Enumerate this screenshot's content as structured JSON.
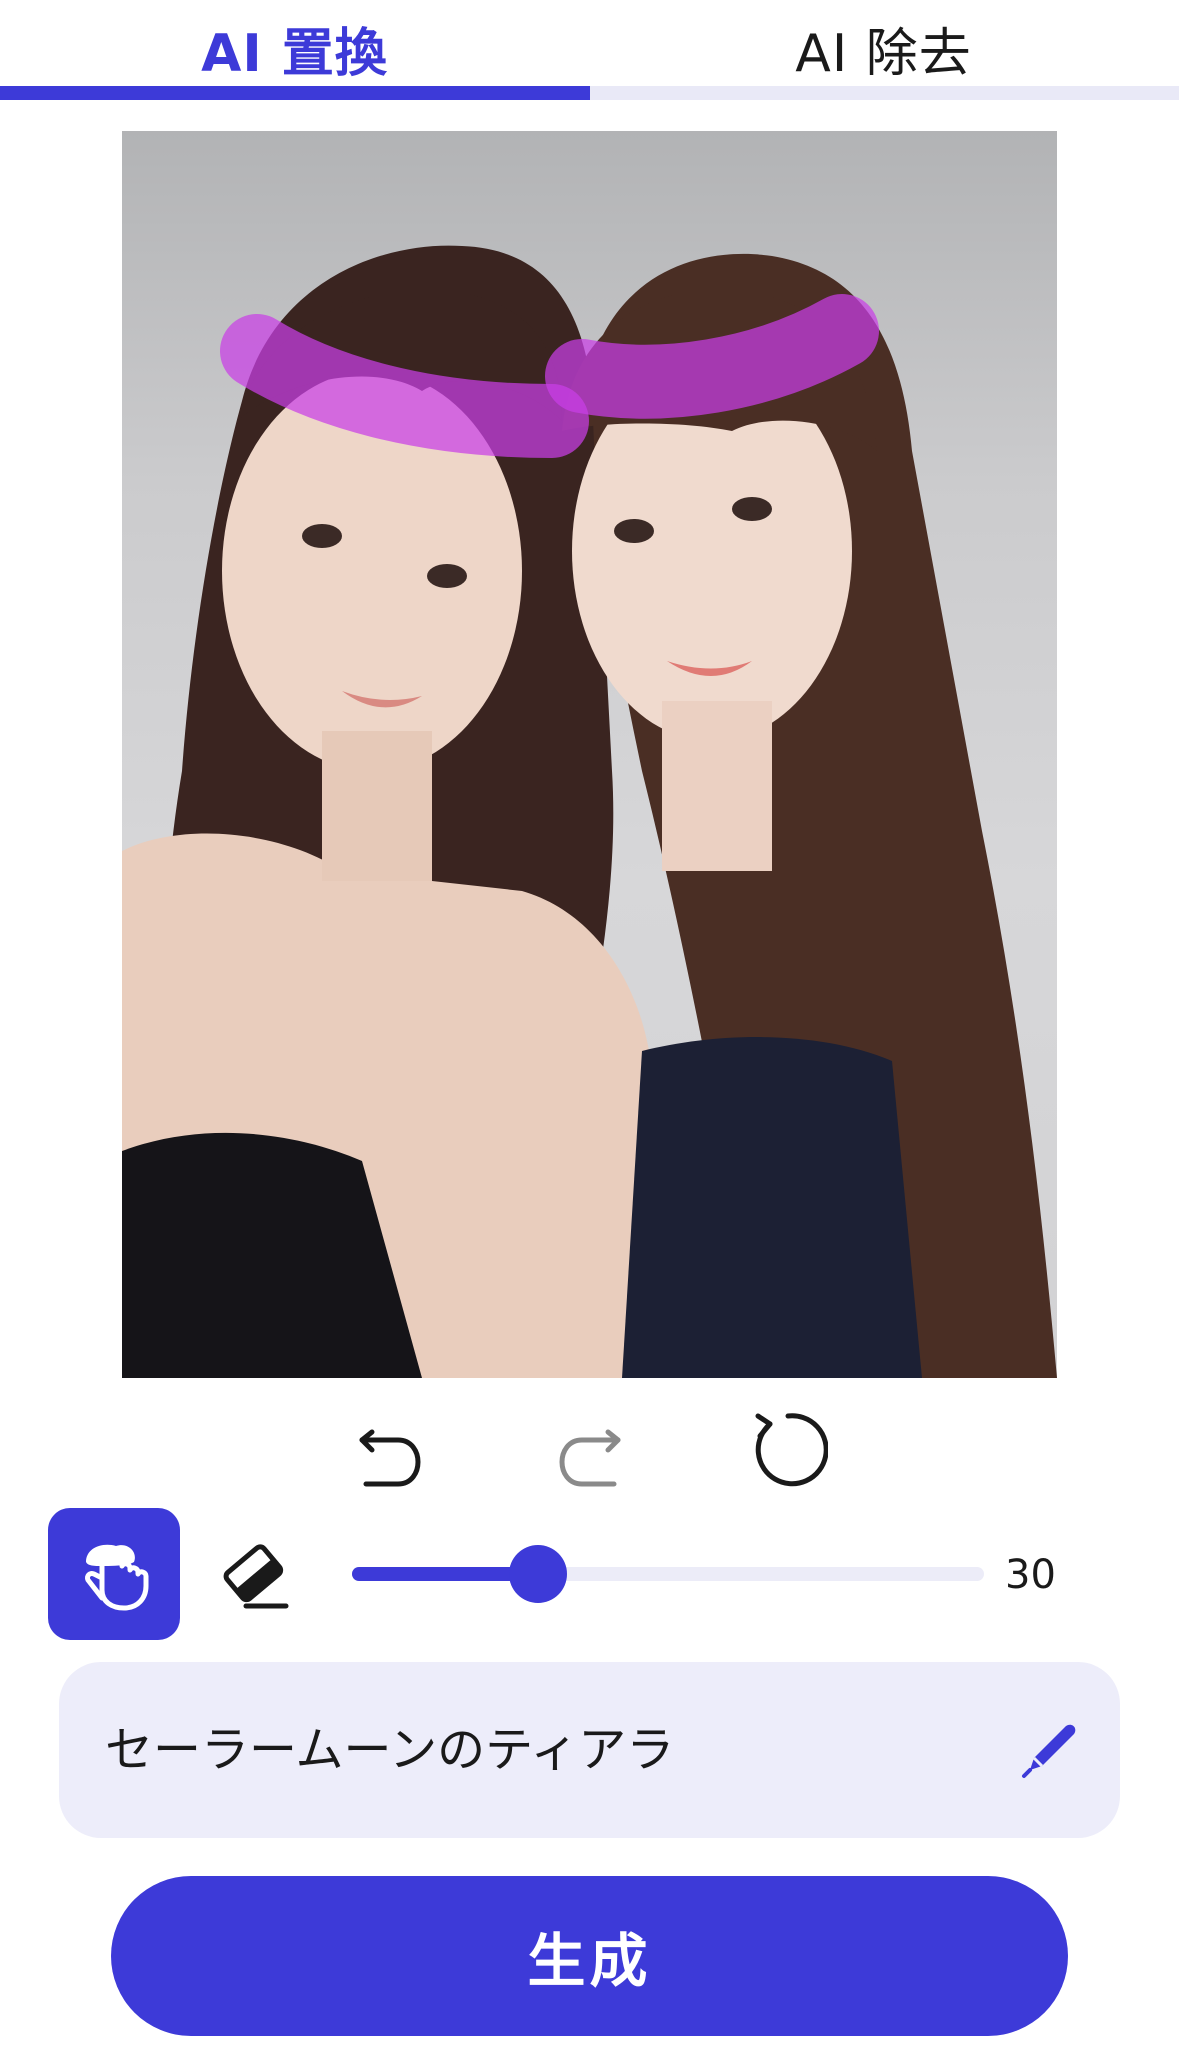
{
  "tabs": [
    {
      "label": "AI 置換",
      "active": true
    },
    {
      "label": "AI 除去",
      "active": false
    }
  ],
  "colors": {
    "accent": "#3d3ad8",
    "mask": "#c93ee6",
    "prompt_bg": "#ededfa",
    "track_bg": "#ececf8"
  },
  "canvas": {
    "image_kind": "photo of two women with long dark brown hair",
    "mask_color": "#c93ee6"
  },
  "history": {
    "undo_icon": "undo-icon",
    "redo_icon": "redo-icon",
    "reset_icon": "reset-icon"
  },
  "toolbar": {
    "brush_icon": "brush-hand-icon",
    "eraser_icon": "eraser-icon",
    "brush_size": 30,
    "brush_size_fraction": 0.295,
    "brush_size_label": "30"
  },
  "prompt": {
    "value": "セーラームーンのティアラ",
    "edit_icon": "pen-icon"
  },
  "generate_label": "生成"
}
